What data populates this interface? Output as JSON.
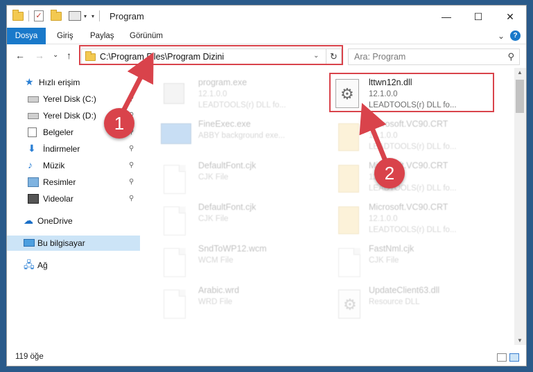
{
  "window": {
    "title": "Program",
    "minimize": "—",
    "maximize": "☐",
    "close": "✕"
  },
  "quick_access_toolbar": {
    "properties_check": "✓",
    "customize_caret": "▾"
  },
  "ribbon": {
    "tabs": [
      "Dosya",
      "Giriş",
      "Paylaş",
      "Görünüm"
    ],
    "expand": "⌄",
    "help": "?"
  },
  "nav": {
    "back": "←",
    "forward": "→",
    "recent": "⌄",
    "up": "↑",
    "address": "C:\\Program Files\\Program Dizini",
    "address_caret": "⌄",
    "refresh": "↻",
    "search_placeholder": "Ara: Program",
    "search_icon": "⚲"
  },
  "sidebar": {
    "items": [
      {
        "label": "Hızlı erişim",
        "icon": "star-icon"
      },
      {
        "label": "Yerel Disk (C:)",
        "icon": "disk-icon",
        "pinned": true
      },
      {
        "label": "Yerel Disk (D:)",
        "icon": "disk-icon",
        "pinned": true
      },
      {
        "label": "Belgeler",
        "icon": "documents-icon",
        "pinned": true
      },
      {
        "label": "İndirmeler",
        "icon": "downloads-icon",
        "pinned": true
      },
      {
        "label": "Müzik",
        "icon": "music-icon",
        "pinned": true
      },
      {
        "label": "Resimler",
        "icon": "pictures-icon",
        "pinned": true
      },
      {
        "label": "Videolar",
        "icon": "videos-icon",
        "pinned": true
      },
      {
        "label": "OneDrive",
        "icon": "cloud-icon"
      },
      {
        "label": "Bu bilgisayar",
        "icon": "computer-icon",
        "selected": true
      },
      {
        "label": "Ağ",
        "icon": "network-icon"
      }
    ],
    "pin_glyph": "📌"
  },
  "files": {
    "left": [
      {
        "name": "program.exe",
        "line1": "12.1.0.0",
        "line2": "LEADTOOLS(r) DLL fo...",
        "icon": "exe"
      },
      {
        "name": "FineExec.exe",
        "line1": "ABBY background exe...",
        "line2": "",
        "icon": "exe-blue"
      },
      {
        "name": "DefaultFont.cjk",
        "line1": "CJK File",
        "line2": "",
        "icon": "doc"
      },
      {
        "name": "DefaultFont.cjk",
        "line1": "CJK File",
        "line2": "",
        "icon": "doc"
      },
      {
        "name": "SndToWP12.wcm",
        "line1": "WCM File",
        "line2": "",
        "icon": "doc"
      },
      {
        "name": "Arabic.wrd",
        "line1": "WRD File",
        "line2": "",
        "icon": "doc"
      }
    ],
    "right": [
      {
        "name": "lttwn12n.dll",
        "line1": "12.1.0.0",
        "line2": "LEADTOOLS(r) DLL fo...",
        "icon": "gear-doc",
        "highlighted": true
      },
      {
        "name": "Microsoft.VC90.CRT",
        "line1": "12.1.0.0",
        "line2": "LEADTOOLS(r) DLL fo...",
        "icon": "folder-doc"
      },
      {
        "name": "Microsoft.VC90.CRT",
        "line1": "12.1.0.0",
        "line2": "LEADTOOLS(r) DLL fo...",
        "icon": "folder-doc"
      },
      {
        "name": "Microsoft.VC90.CRT",
        "line1": "12.1.0.0",
        "line2": "LEADTOOLS(r) DLL fo...",
        "icon": "folder-doc"
      },
      {
        "name": "FastNml.cjk",
        "line1": "CJK File",
        "line2": "",
        "icon": "doc"
      },
      {
        "name": "UpdateClient63.dll",
        "line1": "Resource DLL",
        "line2": "",
        "icon": "gear-doc"
      }
    ]
  },
  "scrollbar": {
    "up": "▲",
    "down": "▼"
  },
  "status": {
    "item_count": "119 öğe"
  },
  "annotations": {
    "step1": "1",
    "step2": "2",
    "color": "#d9434b"
  }
}
